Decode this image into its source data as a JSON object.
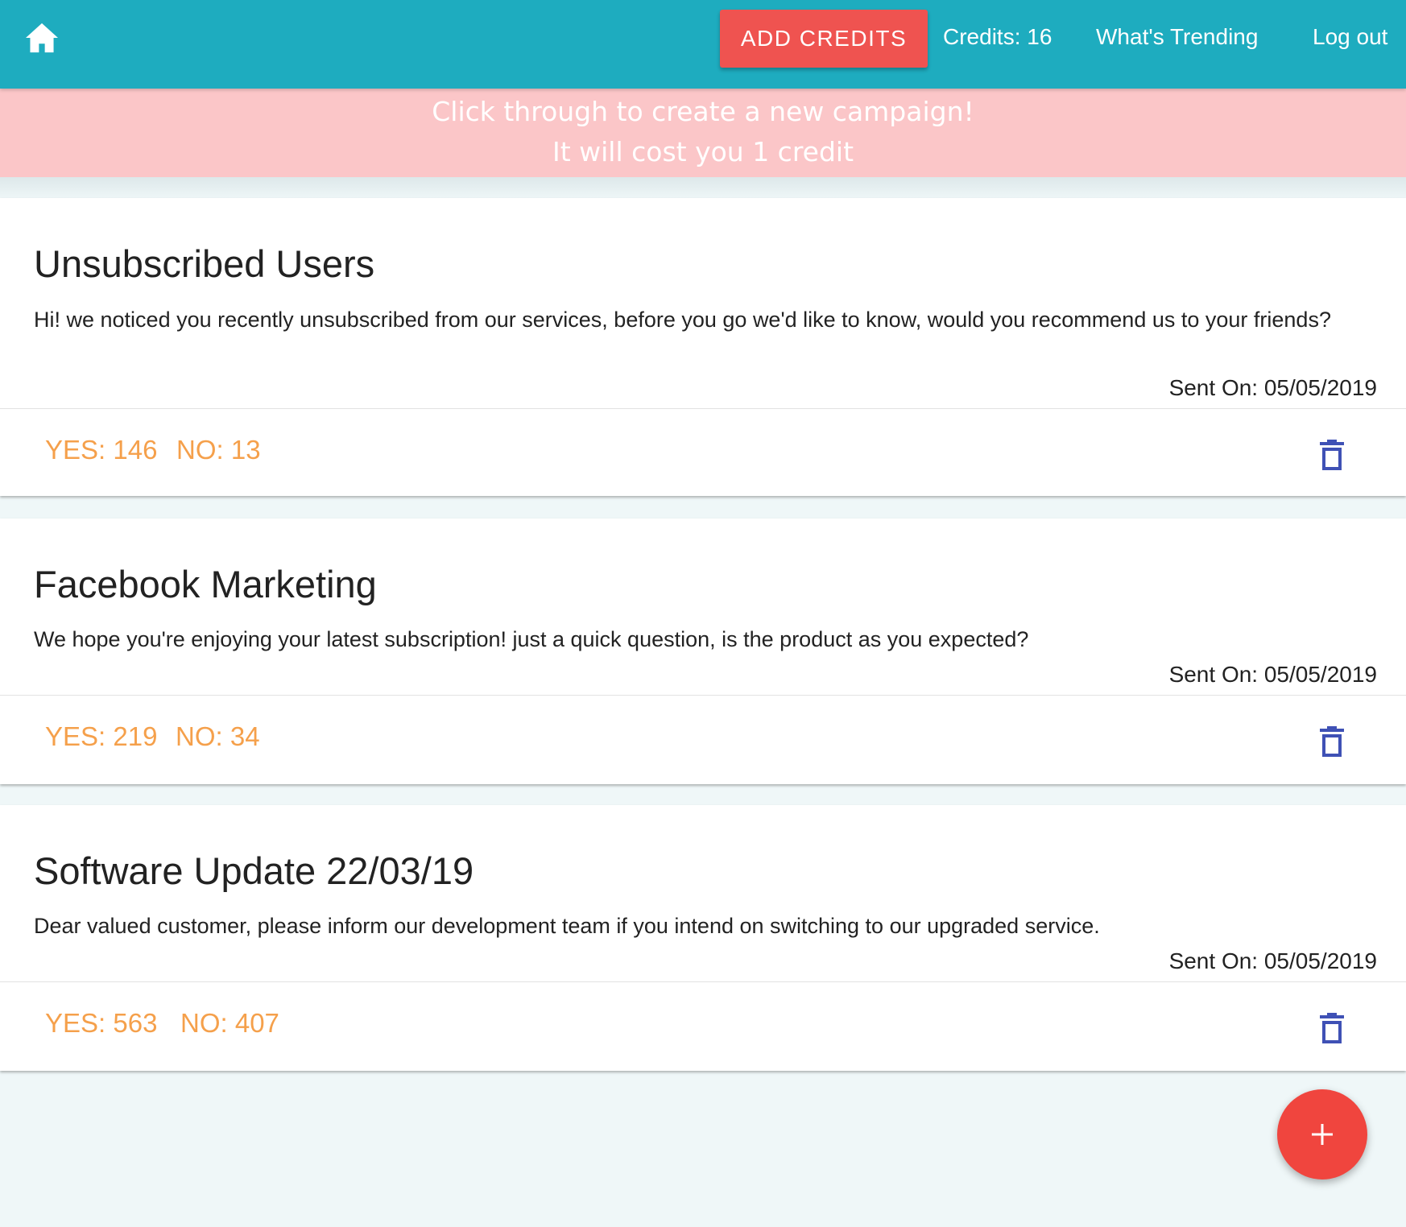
{
  "navbar": {
    "home_icon": "home-icon",
    "add_credits_label": "ADD CREDITS",
    "credits_label": "Credits: 16",
    "trending_label": "What's Trending",
    "logout_label": "Log out",
    "accent_color": "#1eacbf",
    "button_color": "#ef5350"
  },
  "banner": {
    "line1": "Click through to create a new campaign!",
    "line2": "It will cost you 1 credit",
    "color": "#fbc6c8"
  },
  "campaigns": [
    {
      "title": "Unsubscribed Users",
      "body": "Hi! we noticed you recently unsubscribed from our services, before you go we'd like to know, would you recommend us to your friends?",
      "sent_on": "Sent On: 05/05/2019",
      "yes_label": "YES: 146",
      "no_label": "NO: 13",
      "delete_icon": "trash-icon"
    },
    {
      "title": "Facebook Marketing",
      "body": "We hope you're enjoying your latest subscription! just a quick question, is the product as you expected?",
      "sent_on": "Sent On: 05/05/2019",
      "yes_label": "YES: 219",
      "no_label": "NO: 34",
      "delete_icon": "trash-icon"
    },
    {
      "title": "Software Update 22/03/19",
      "body": "Dear valued customer, please inform our development team if you intend on switching to our upgraded service.",
      "sent_on": "Sent On: 05/05/2019",
      "yes_label": "YES: 563",
      "no_label": "NO: 407",
      "delete_icon": "trash-icon"
    }
  ],
  "fab": {
    "icon": "plus-icon",
    "color": "#f0453e"
  },
  "colors": {
    "count_text": "#f5a04b",
    "trash_icon": "#3f51b5",
    "page_background": "#eff7f8"
  }
}
